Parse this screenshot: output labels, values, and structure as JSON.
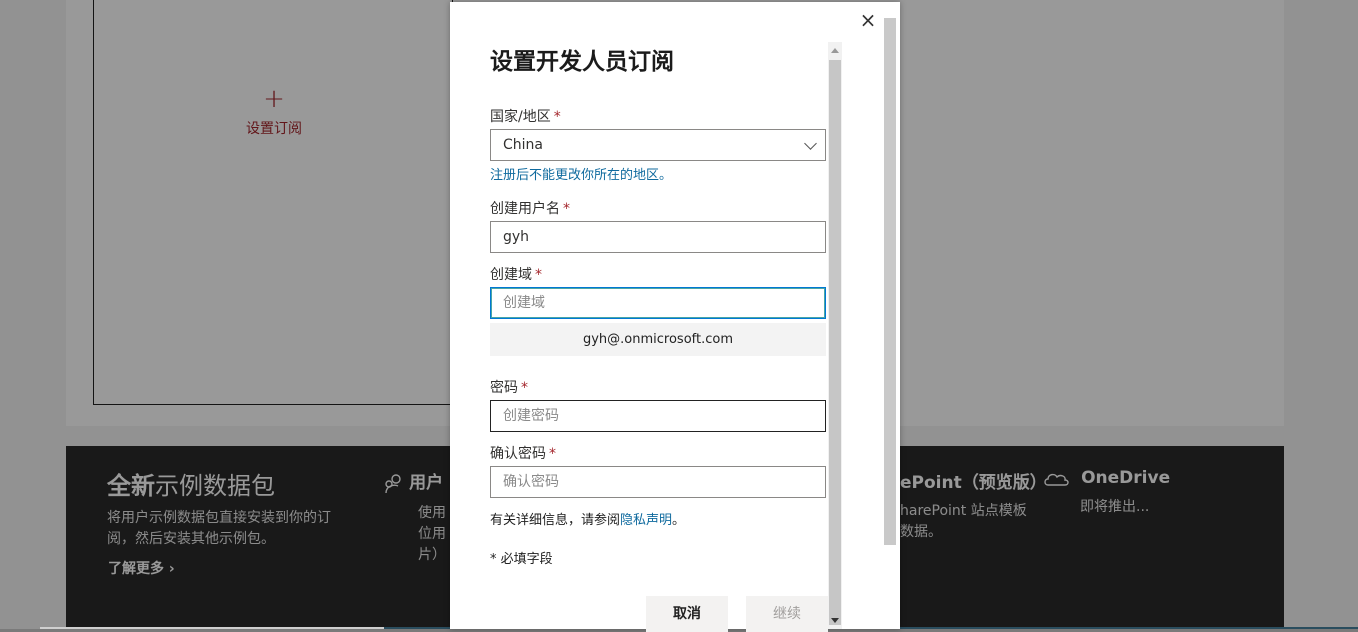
{
  "background": {
    "card_add_symbol": "+",
    "card_add_label": "设置订阅",
    "band": {
      "title_bold": "全新",
      "title_rest": "示例数据包",
      "description": "将用户示例数据包直接安装到你的订阅，然后安装其他示例包。",
      "learn_more": "了解更多",
      "col_users": {
        "heading": "用户",
        "text_lines": [
          "使用",
          "位用",
          "片）"
        ]
      },
      "col_sharepoint": {
        "heading": "ePoint（预览版）",
        "text_lines": [
          "harePoint 站点模板",
          "数据。"
        ]
      },
      "col_onedrive": {
        "heading": "OneDrive",
        "text": "即将推出..."
      }
    }
  },
  "dialog": {
    "close_symbol": "×",
    "title": "设置开发人员订阅",
    "required_mark": "*",
    "country": {
      "label": "国家/地区",
      "value": "China",
      "note": "注册后不能更改你所在的地区。"
    },
    "username": {
      "label": "创建用户名",
      "value": "gyh"
    },
    "domain": {
      "label": "创建域",
      "placeholder": "创建域",
      "preview": "gyh@.onmicrosoft.com"
    },
    "password": {
      "label": "密码",
      "placeholder": "创建密码"
    },
    "confirm_password": {
      "label": "确认密码",
      "placeholder": "确认密码"
    },
    "privacy": {
      "prefix": "有关详细信息，请参阅",
      "link": "隐私声明",
      "suffix": "。"
    },
    "required_note": "* 必填字段",
    "buttons": {
      "cancel": "取消",
      "continue": "继续"
    }
  },
  "colors": {
    "accent_red": "#a4262c",
    "link_blue": "#0f6a9e",
    "focus_border": "#0078d4",
    "dark_band": "#2b2b2b"
  }
}
